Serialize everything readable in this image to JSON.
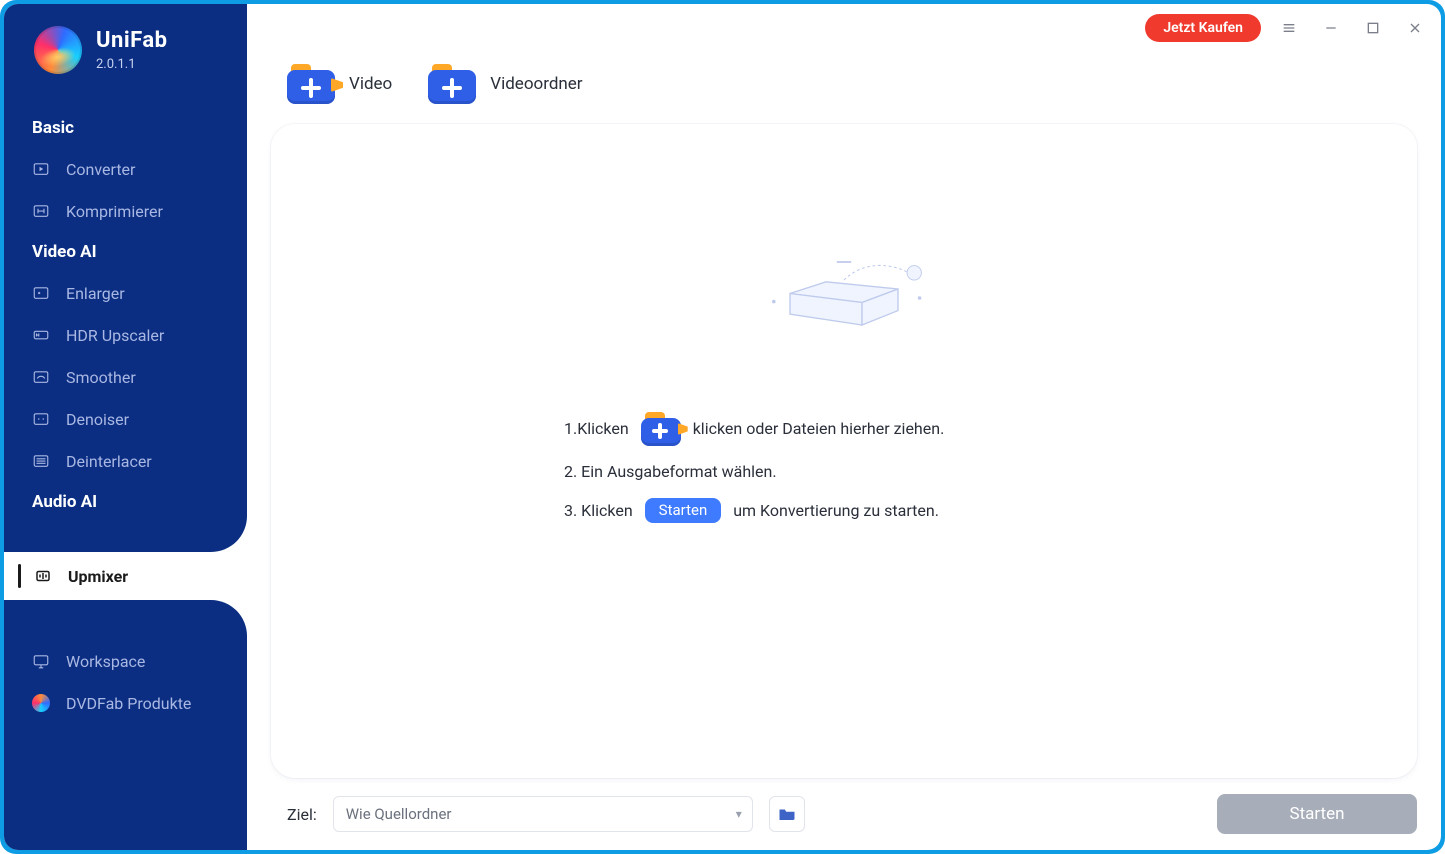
{
  "brand": {
    "name": "UniFab",
    "version": "2.0.1.1"
  },
  "titlebar": {
    "buy_label": "Jetzt Kaufen"
  },
  "sidebar": {
    "section_basic": "Basic",
    "section_videoai": "Video AI",
    "section_audioai": "Audio AI",
    "items": {
      "converter": "Converter",
      "komprimierer": "Komprimierer",
      "enlarger": "Enlarger",
      "hdr": "HDR Upscaler",
      "smoother": "Smoother",
      "denoiser": "Denoiser",
      "deinterlacer": "Deinterlacer",
      "upmixer": "Upmixer",
      "workspace": "Workspace",
      "dvdfab": "DVDFab Produkte"
    }
  },
  "toolbar": {
    "video_label": "Video",
    "folder_label": "Videoordner"
  },
  "steps": {
    "s1a": "1.Klicken",
    "s1b": "klicken oder Dateien hierher ziehen.",
    "s2": "2. Ein Ausgabeformat wählen.",
    "s3a": "3. Klicken",
    "s3_chip": "Starten",
    "s3b": "um Konvertierung zu starten."
  },
  "bottom": {
    "dest_label": "Ziel:",
    "dest_value": "Wie Quellordner",
    "start_label": "Starten"
  }
}
